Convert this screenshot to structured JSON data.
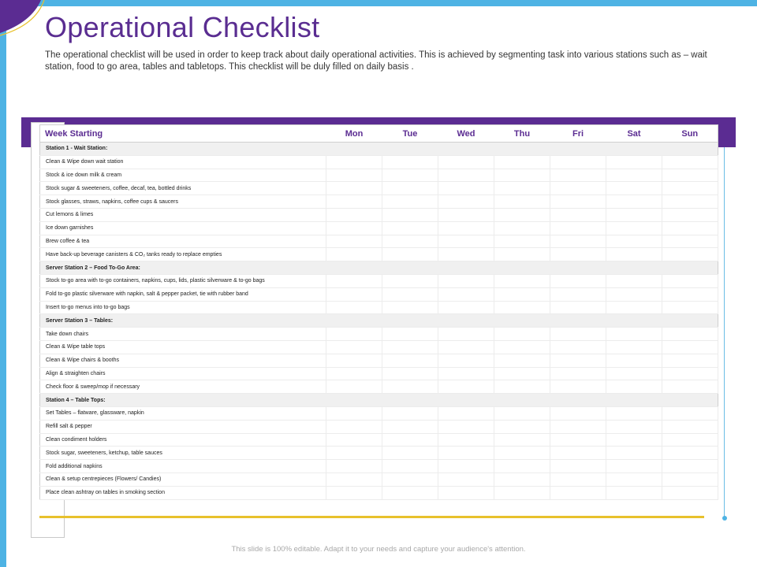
{
  "slide": {
    "title": "Operational Checklist",
    "description": "The operational checklist will be used in order to keep track about daily operational activities. This is achieved by segmenting task into various stations such as – wait station, food to go area, tables and tabletops. This checklist will be duly filled on daily basis .",
    "footer": "This slide is 100% editable. Adapt it to your needs and capture your audience's attention."
  },
  "colors": {
    "accent_purple": "#5b2c92",
    "accent_blue": "#4eb3e4",
    "accent_gold": "#e8c12c",
    "section_fill": "#f0f0f0"
  },
  "table": {
    "header": {
      "task": "Week Starting",
      "days": [
        "Mon",
        "Tue",
        "Wed",
        "Thu",
        "Fri",
        "Sat",
        "Sun"
      ]
    },
    "sections": [
      {
        "title": "Station 1 - Wait Station:",
        "tasks": [
          "Clean & Wipe down wait station",
          "Stock & ice down milk & cream",
          "Stock sugar & sweeteners, coffee, decaf, tea, bottled drinks",
          "Stock glasses, straws, napkins, coffee cups & saucers",
          "Cut lemons & limes",
          "Ice down garnishes",
          "Brew coffee & tea",
          "Have back-up beverage canisters & CO₂ tanks ready to replace empties"
        ]
      },
      {
        "title": "Server Station 2 – Food To-Go Area:",
        "tasks": [
          "Stock to-go area with to-go containers, napkins, cups, lids, plastic silverware & to-go bags",
          "Fold to-go plastic silverware with napkin, salt & pepper packet, tie with rubber band",
          "Insert to-go menus into to-go bags"
        ]
      },
      {
        "title": "Server Station 3 – Tables:",
        "tasks": [
          "Take down chairs",
          "Clean & Wipe table tops",
          "Clean & Wipe chairs & booths",
          "Align & straighten chairs",
          "Check floor & sweep/mop if necessary"
        ]
      },
      {
        "title": "Station 4 – Table Tops:",
        "tasks": [
          "Set Tables – flatware, glassware, napkin",
          "Refill salt & pepper",
          "Clean condiment holders",
          "Stock sugar, sweeteners, ketchup, table sauces",
          "Fold additional napkins",
          "Clean & setup centrepieces (Flowers/ Candies)",
          "Place clean ashtray on tables in smoking section"
        ]
      }
    ]
  }
}
